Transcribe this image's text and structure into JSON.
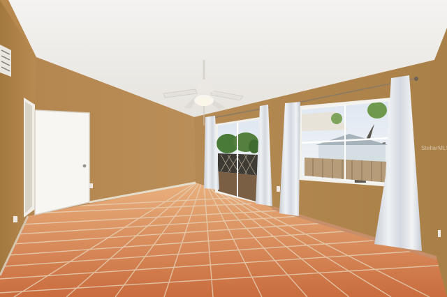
{
  "watermark": "StellarMLS",
  "colors": {
    "wall": "#b3874f",
    "wall_shadow": "#9c7240",
    "ceiling": "#f1efeb",
    "trim": "#ece6da",
    "tile": "#c86f42",
    "grout": "#e6d3bb",
    "curtain": "#dfe3e8",
    "sky": "#e9eef5",
    "foliage": "#4e7a3a",
    "deck": "#7a5f44"
  },
  "icons": [
    "ceiling-fan-icon",
    "air-vent-icon",
    "door-handle-icon",
    "outlet-icon"
  ]
}
